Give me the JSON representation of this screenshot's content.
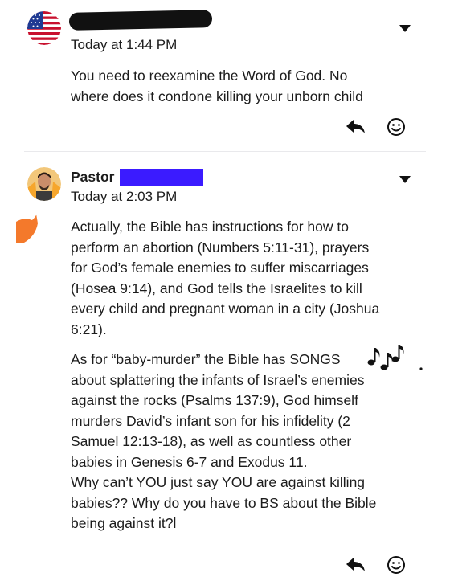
{
  "comments": [
    {
      "author": "",
      "timestamp": "Today at 1:44 PM",
      "paragraphs": [
        "You need to reexamine the Word of God. No",
        "where does it condone killing your unborn child"
      ],
      "avatar_icon": "us-flag-avatar",
      "name_redaction_color": "#111111"
    },
    {
      "author": "Pastor",
      "timestamp": "Today at 2:03 PM",
      "avatar_icon": "person-avatar",
      "name_redaction_color": "#3b1bff",
      "paragraphs": [
        "Actually, the Bible has instructions for how to",
        "perform an abortion (Numbers 5:11-31), prayers",
        "for God’s female enemies to suffer miscarriages",
        "(Hosea 9:14), and God tells the Israelites to kill",
        "every child and pregnant woman in a city (Joshua",
        "6:21).",
        "As for “baby-murder” the Bible has SONGS",
        "about splattering the infants of Israel’s enemies",
        "against the rocks (Psalms 137:9), God himself",
        "murders David’s infant son for his infidelity (2",
        "Samuel 12:13-18), as well as countless other",
        "babies in Genesis 6-7 and Exodus 11.",
        "Why can’t YOU just say YOU are against killing",
        "babies?? Why do you have to BS about the Bible",
        "being against it?l"
      ]
    }
  ],
  "icons": {
    "reply": "reply-icon",
    "reaction": "smiley-icon",
    "menu": "chevron-down-icon",
    "music": "music-notes-icon"
  }
}
